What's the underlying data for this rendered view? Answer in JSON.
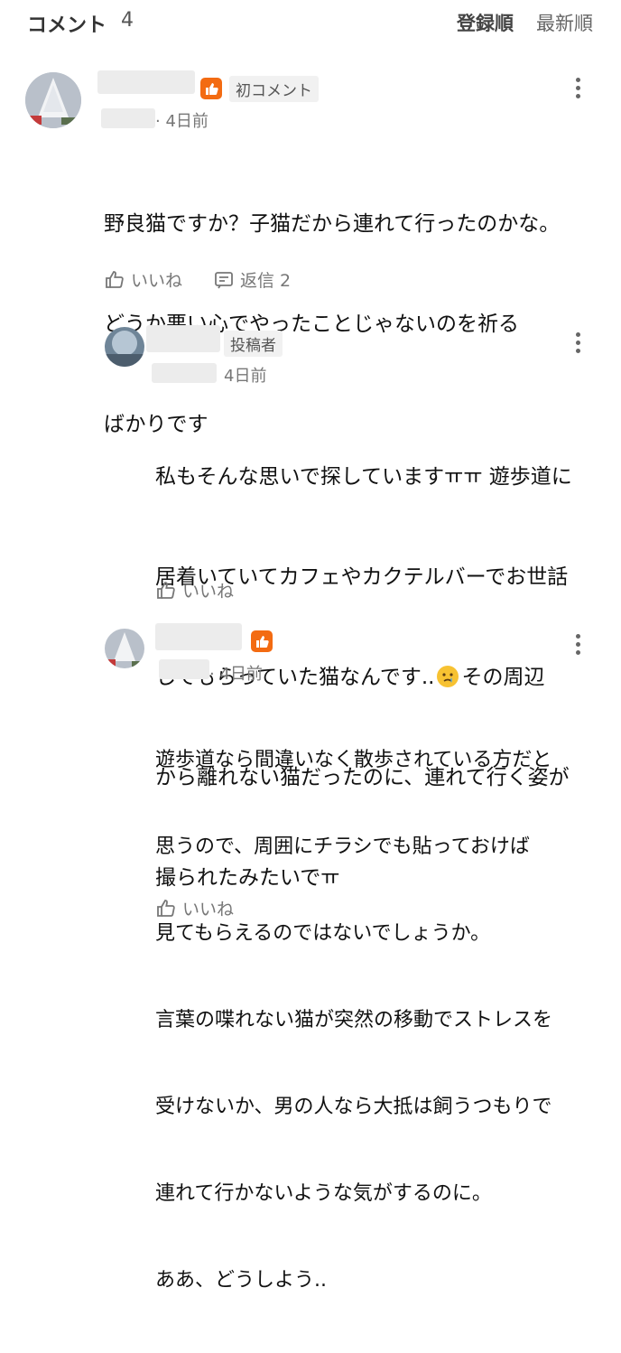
{
  "header": {
    "title": "コメント",
    "count": "4",
    "sort_registered": "登録順",
    "sort_newest": "最新順"
  },
  "comments": [
    {
      "tag": "初コメント",
      "time": "· 4日前",
      "lines": [
        "野良猫ですか？子猫だから連れて行ったのかな。",
        "どうか悪い心でやったことじゃないのを祈る",
        "ばかりです"
      ],
      "like_label": "いいね",
      "reply_label": "返信 2"
    },
    {
      "tag": "投稿者",
      "time": "4日前",
      "lines": [
        "私もそんな思いで探していますㅠㅠ 遊歩道に",
        "居着いていてカフェやカクテルバーでお世話",
        "してもらっていた猫なんです..",
        "から離れない猫だったのに、連れて行く姿が",
        "撮られたみたいでㅠ"
      ],
      "line3_suffix": "その周辺",
      "like_label": "いいね"
    },
    {
      "time": "· 4日前",
      "lines": [
        "遊歩道なら間違いなく散歩されている方だと",
        "思うので、周囲にチラシでも貼っておけば",
        "見てもらえるのではないでしょうか。",
        "言葉の喋れない猫が突然の移動でストレスを",
        "受けないか、男の人なら大抵は飼うつもりで",
        "連れて行かないような気がするのに。",
        "ああ、どうしよう.."
      ],
      "like_label": "いいね"
    }
  ],
  "colors": {
    "badge": "#f36b12",
    "text": "#111111",
    "muted": "#777777"
  },
  "icons": [
    "thumbs-up-icon",
    "reply-icon",
    "more-vertical-icon",
    "crying-face-emoji"
  ]
}
